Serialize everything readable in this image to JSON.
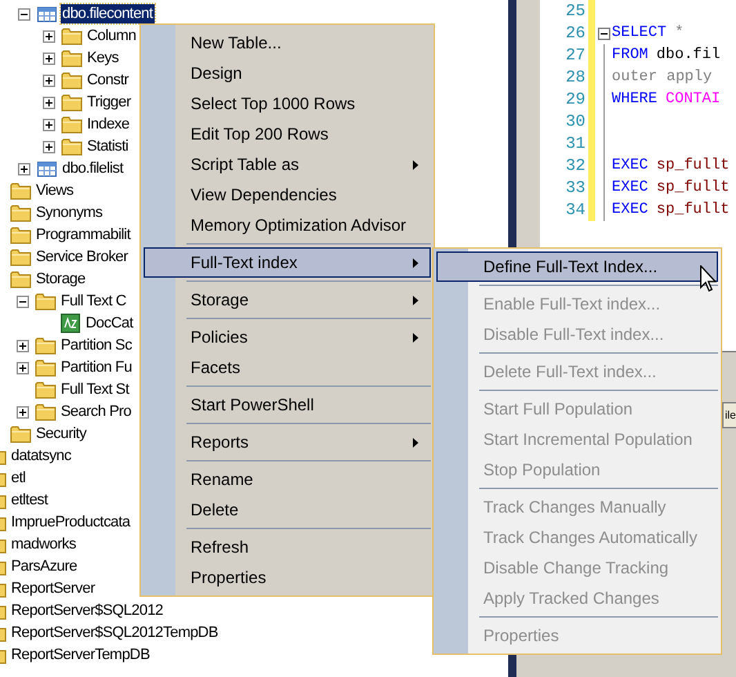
{
  "object_explorer": {
    "tables": [
      {
        "label": "dbo.filecontent",
        "kind": "table",
        "selected": true,
        "expanded": true,
        "children": [
          {
            "label": "Column",
            "kind": "folder",
            "selected": false,
            "expanded": false
          },
          {
            "label": "Keys",
            "kind": "folder",
            "selected": false,
            "expanded": false
          },
          {
            "label": "Constr",
            "kind": "folder",
            "selected": false,
            "expanded": false
          },
          {
            "label": "Trigger",
            "kind": "folder",
            "selected": false,
            "expanded": false
          },
          {
            "label": "Indexe",
            "kind": "folder",
            "selected": false,
            "expanded": false
          },
          {
            "label": "Statisti",
            "kind": "folder",
            "selected": false,
            "expanded": false
          }
        ]
      },
      {
        "label": "dbo.filelist",
        "kind": "table",
        "selected": false,
        "expanded": false
      }
    ],
    "folders": [
      {
        "label": "Views",
        "kind": "folder",
        "selected": false
      },
      {
        "label": "Synonyms",
        "kind": "folder",
        "selected": false
      },
      {
        "label": "Programmabilit",
        "kind": "folder",
        "selected": false
      },
      {
        "label": "Service Broker",
        "kind": "folder",
        "selected": false
      },
      {
        "label": "Storage",
        "kind": "folder",
        "selected": false,
        "children": [
          {
            "label": "Full Text C",
            "kind": "folder",
            "selected": false,
            "expanded": true,
            "children": [
              {
                "label": "DocCat",
                "kind": "catalog",
                "selected": false
              }
            ]
          },
          {
            "label": "Partition Sc",
            "kind": "folder",
            "selected": false,
            "expanded": false
          },
          {
            "label": "Partition Fu",
            "kind": "folder",
            "selected": false,
            "expanded": false
          },
          {
            "label": "Full Text St",
            "kind": "folder",
            "selected": false
          },
          {
            "label": "Search Pro",
            "kind": "folder",
            "selected": false,
            "expanded": false
          }
        ]
      },
      {
        "label": "Security",
        "kind": "folder",
        "selected": false
      }
    ],
    "databases": [
      {
        "label": "datatsync",
        "kind": "database",
        "selected": false
      },
      {
        "label": "etl",
        "kind": "database",
        "selected": false
      },
      {
        "label": "etltest",
        "kind": "database",
        "selected": false
      },
      {
        "label": "ImprueProductcata",
        "kind": "database",
        "selected": false
      },
      {
        "label": "madworks",
        "kind": "database",
        "selected": false
      },
      {
        "label": "ParsAzure",
        "kind": "database",
        "selected": false
      },
      {
        "label": "ReportServer",
        "kind": "database",
        "selected": false
      },
      {
        "label": "ReportServer$SQL2012",
        "kind": "database",
        "selected": false
      },
      {
        "label": "ReportServer$SQL2012TempDB",
        "kind": "database",
        "selected": false
      },
      {
        "label": "ReportServerTempDB",
        "kind": "database",
        "selected": false
      }
    ]
  },
  "editor": {
    "lines": [
      {
        "number": "25"
      },
      {
        "number": "26",
        "folded": false,
        "tokens": [
          {
            "text": "SELECT",
            "kind": "keyword"
          },
          {
            "text": "*",
            "kind": "operator"
          }
        ]
      },
      {
        "number": "27",
        "tokens": [
          {
            "text": "FROM",
            "kind": "keyword"
          },
          {
            "text": "dbo.fil",
            "kind": "identifier"
          }
        ]
      },
      {
        "number": "28",
        "tokens": [
          {
            "text": "outer apply",
            "kind": "operator"
          }
        ]
      },
      {
        "number": "29",
        "tokens": [
          {
            "text": "WHERE",
            "kind": "keyword"
          },
          {
            "text": "CONTAI",
            "kind": "function"
          }
        ]
      },
      {
        "number": "30"
      },
      {
        "number": "31"
      },
      {
        "number": "32",
        "tokens": [
          {
            "text": "EXEC",
            "kind": "keyword"
          },
          {
            "text": "sp_fullt",
            "kind": "procedure"
          }
        ]
      },
      {
        "number": "33",
        "tokens": [
          {
            "text": "EXEC",
            "kind": "keyword"
          },
          {
            "text": "sp_fullt",
            "kind": "procedure"
          }
        ]
      },
      {
        "number": "34",
        "tokens": [
          {
            "text": "EXEC",
            "kind": "keyword"
          },
          {
            "text": "sp_fullt",
            "kind": "procedure"
          }
        ]
      }
    ]
  },
  "results_tab": {
    "label": "ile"
  },
  "context_menu": {
    "items": [
      {
        "kind": "item",
        "label": "New Table...",
        "selected": false,
        "disabled": false,
        "submenu": false
      },
      {
        "kind": "item",
        "label": "Design",
        "selected": false,
        "disabled": false,
        "submenu": false
      },
      {
        "kind": "item",
        "label": "Select Top 1000 Rows",
        "selected": false,
        "disabled": false,
        "submenu": false
      },
      {
        "kind": "item",
        "label": "Edit Top 200 Rows",
        "selected": false,
        "disabled": false,
        "submenu": false
      },
      {
        "kind": "item",
        "label": "Script Table as",
        "selected": false,
        "disabled": false,
        "submenu": true
      },
      {
        "kind": "item",
        "label": "View Dependencies",
        "selected": false,
        "disabled": false,
        "submenu": false
      },
      {
        "kind": "item",
        "label": "Memory Optimization Advisor",
        "selected": false,
        "disabled": false,
        "submenu": false
      },
      {
        "kind": "separator"
      },
      {
        "kind": "item",
        "label": "Full-Text index",
        "selected": true,
        "disabled": false,
        "submenu": true
      },
      {
        "kind": "separator"
      },
      {
        "kind": "item",
        "label": "Storage",
        "selected": false,
        "disabled": false,
        "submenu": true
      },
      {
        "kind": "separator"
      },
      {
        "kind": "item",
        "label": "Policies",
        "selected": false,
        "disabled": false,
        "submenu": true
      },
      {
        "kind": "item",
        "label": "Facets",
        "selected": false,
        "disabled": false,
        "submenu": false
      },
      {
        "kind": "separator"
      },
      {
        "kind": "item",
        "label": "Start PowerShell",
        "selected": false,
        "disabled": false,
        "submenu": false
      },
      {
        "kind": "separator"
      },
      {
        "kind": "item",
        "label": "Reports",
        "selected": false,
        "disabled": false,
        "submenu": true
      },
      {
        "kind": "separator"
      },
      {
        "kind": "item",
        "label": "Rename",
        "selected": false,
        "disabled": false,
        "submenu": false
      },
      {
        "kind": "item",
        "label": "Delete",
        "selected": false,
        "disabled": false,
        "submenu": false
      },
      {
        "kind": "separator"
      },
      {
        "kind": "item",
        "label": "Refresh",
        "selected": false,
        "disabled": false,
        "submenu": false
      },
      {
        "kind": "item",
        "label": "Properties",
        "selected": false,
        "disabled": false,
        "submenu": false
      }
    ]
  },
  "submenu": {
    "items": [
      {
        "kind": "item",
        "label": "Define Full-Text Index...",
        "selected": true,
        "disabled": false
      },
      {
        "kind": "separator"
      },
      {
        "kind": "item",
        "label": "Enable Full-Text index...",
        "selected": false,
        "disabled": true
      },
      {
        "kind": "item",
        "label": "Disable Full-Text index...",
        "selected": false,
        "disabled": true
      },
      {
        "kind": "separator"
      },
      {
        "kind": "item",
        "label": "Delete Full-Text index...",
        "selected": false,
        "disabled": true
      },
      {
        "kind": "separator"
      },
      {
        "kind": "item",
        "label": "Start Full Population",
        "selected": false,
        "disabled": true
      },
      {
        "kind": "item",
        "label": "Start Incremental Population",
        "selected": false,
        "disabled": true
      },
      {
        "kind": "item",
        "label": "Stop Population",
        "selected": false,
        "disabled": true
      },
      {
        "kind": "separator"
      },
      {
        "kind": "item",
        "label": "Track Changes Manually",
        "selected": false,
        "disabled": true
      },
      {
        "kind": "item",
        "label": "Track Changes Automatically",
        "selected": false,
        "disabled": true
      },
      {
        "kind": "item",
        "label": "Disable Change Tracking",
        "selected": false,
        "disabled": true
      },
      {
        "kind": "item",
        "label": "Apply Tracked Changes",
        "selected": false,
        "disabled": true
      },
      {
        "kind": "separator"
      },
      {
        "kind": "item",
        "label": "Properties",
        "selected": false,
        "disabled": true
      }
    ]
  }
}
